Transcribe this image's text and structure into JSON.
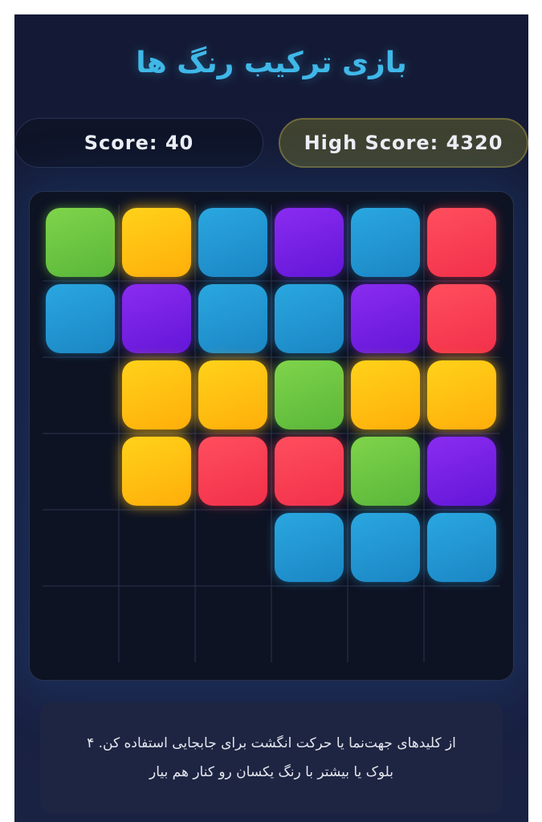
{
  "header": {
    "title": "بازی ترکیب رنگ ها"
  },
  "scores": {
    "current_label": "Score: 40",
    "high_label": "High Score: 4320"
  },
  "board": {
    "rows": 6,
    "cols": 6,
    "colors": {
      "green": "#6cc742",
      "yellow": "#ffc012",
      "blue": "#2298d4",
      "purple": "#7722e6",
      "red": "#f93f54"
    },
    "cells": [
      [
        "green",
        "yellow",
        "blue",
        "purple",
        "blue",
        "red"
      ],
      [
        "blue",
        "purple",
        "blue",
        "blue",
        "purple",
        "red"
      ],
      [
        null,
        "yellow",
        "yellow",
        "green",
        "yellow",
        "yellow"
      ],
      [
        null,
        "yellow",
        "red",
        "red",
        "green",
        "purple"
      ],
      [
        null,
        null,
        null,
        "blue",
        "blue",
        "blue"
      ],
      [
        null,
        null,
        null,
        null,
        null,
        null
      ]
    ]
  },
  "instructions": {
    "line1": "از کلیدهای جهت‌نما یا حرکت انگشت برای جابجایی استفاده کن. ۴",
    "line2": "بلوک یا بیشتر با رنگ یکسان رو کنار هم بیار"
  },
  "theme": {
    "accent": "#3fb8e8",
    "background": "#151b38"
  }
}
